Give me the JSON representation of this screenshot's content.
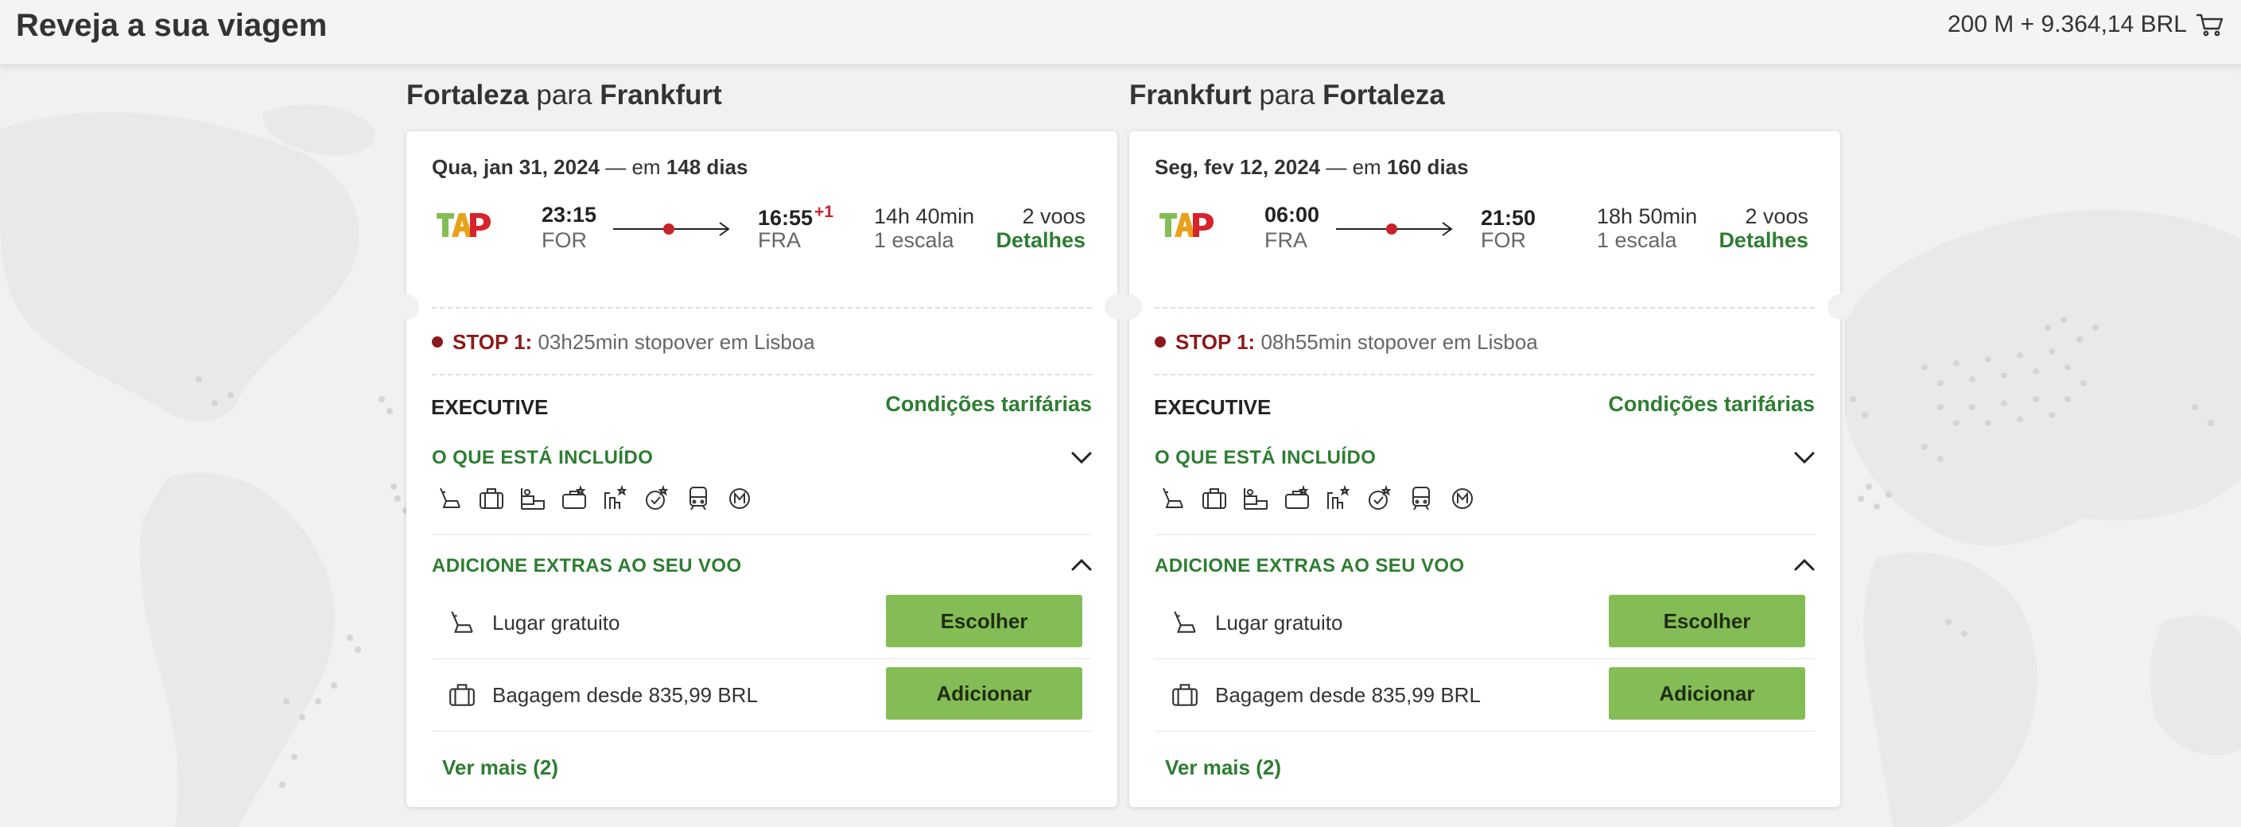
{
  "header": {
    "title": "Reveja a sua viagem",
    "cart_total": "200 M + 9.364,14 BRL",
    "cart_icon": "cart-icon"
  },
  "brand": {
    "logo_text": "TAP",
    "accent_green": "#2e7d32",
    "button_green": "#84bd55",
    "stop_red": "#8b1a1a"
  },
  "outbound": {
    "from": "Fortaleza",
    "connector": "para",
    "to": "Frankfurt",
    "date": "Qua, jan 31, 2024",
    "date_separator": "— em",
    "days_until": "148 dias",
    "departure_time": "23:15",
    "departure_code": "FOR",
    "arrival_time": "16:55",
    "arrival_day_offset": "+1",
    "arrival_code": "FRA",
    "duration": "14h 40min",
    "stops": "1 escala",
    "flights_count": "2 voos",
    "details_label": "Detalhes",
    "stop_label": "STOP 1:",
    "stop_detail": "03h25min stopover em Lisboa",
    "cabin": "EXECUTIVE",
    "fare_conditions_label": "Condições tarifárias",
    "included_title": "O QUE ESTÁ INCLUÍDO",
    "included_icons": [
      "seat-icon",
      "cabin-bag-icon",
      "checked-bag-icon",
      "lounge-icon",
      "priority-checkin-icon",
      "fast-track-icon",
      "train-icon",
      "miles-icon"
    ],
    "extras_title": "ADICIONE EXTRAS AO SEU VOO",
    "extras": [
      {
        "icon": "seat-icon",
        "label": "Lugar gratuito",
        "button": "Escolher"
      },
      {
        "icon": "baggage-icon",
        "label": "Bagagem desde 835,99 BRL",
        "button": "Adicionar"
      }
    ],
    "more_label": "Ver mais (2)"
  },
  "inbound": {
    "from": "Frankfurt",
    "connector": "para",
    "to": "Fortaleza",
    "date": "Seg, fev 12, 2024",
    "date_separator": "— em",
    "days_until": "160 dias",
    "departure_time": "06:00",
    "departure_code": "FRA",
    "arrival_time": "21:50",
    "arrival_day_offset": "",
    "arrival_code": "FOR",
    "duration": "18h 50min",
    "stops": "1 escala",
    "flights_count": "2 voos",
    "details_label": "Detalhes",
    "stop_label": "STOP 1:",
    "stop_detail": "08h55min stopover em Lisboa",
    "cabin": "EXECUTIVE",
    "fare_conditions_label": "Condições tarifárias",
    "included_title": "O QUE ESTÁ INCLUÍDO",
    "included_icons": [
      "seat-icon",
      "cabin-bag-icon",
      "checked-bag-icon",
      "lounge-icon",
      "priority-checkin-icon",
      "fast-track-icon",
      "train-icon",
      "miles-icon"
    ],
    "extras_title": "ADICIONE EXTRAS AO SEU VOO",
    "extras": [
      {
        "icon": "seat-icon",
        "label": "Lugar gratuito",
        "button": "Escolher"
      },
      {
        "icon": "baggage-icon",
        "label": "Bagagem desde 835,99 BRL",
        "button": "Adicionar"
      }
    ],
    "more_label": "Ver mais (2)"
  }
}
